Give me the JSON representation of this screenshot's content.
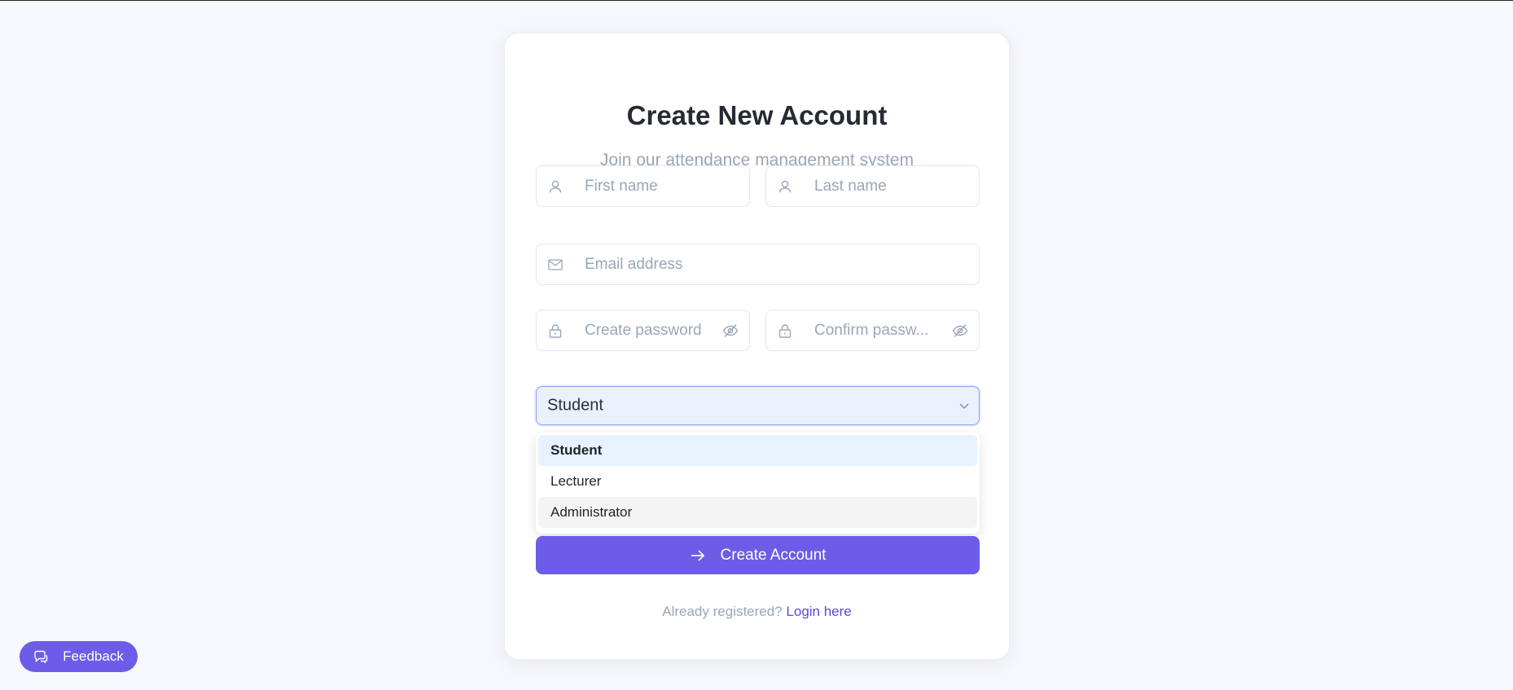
{
  "form": {
    "title": "Create New Account",
    "subtitle": "Join our attendance management system",
    "first_name": {
      "placeholder": "First name",
      "icon": "user-icon"
    },
    "last_name": {
      "placeholder": "Last name",
      "icon": "user-icon"
    },
    "email": {
      "placeholder": "Email address",
      "icon": "mail-icon"
    },
    "password": {
      "placeholder": "Create password",
      "icon": "lock-icon",
      "toggle_icon": "eye-off-icon"
    },
    "confirm_password": {
      "placeholder": "Confirm passw...",
      "icon": "lock-icon",
      "toggle_icon": "eye-off-icon"
    },
    "role_select": {
      "value": "Student",
      "options": [
        "Student",
        "Lecturer",
        "Administrator"
      ],
      "selected_index": 0,
      "hovered_index": 2
    },
    "submit_label": "Create Account",
    "footer_text": "Already registered?",
    "footer_link": "Login here"
  },
  "feedback_button": {
    "label": "Feedback",
    "icon": "chat-icon"
  },
  "colors": {
    "accent": "#6c5ce7",
    "background": "#f7f8fc",
    "placeholder": "#9aa6b7",
    "title": "#262b33"
  }
}
